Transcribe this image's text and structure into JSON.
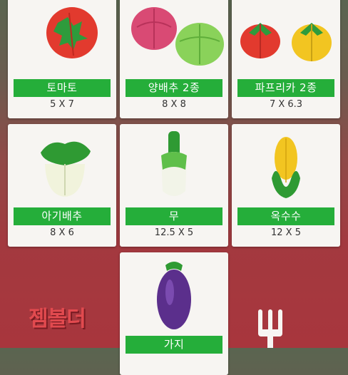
{
  "items": [
    {
      "name": "토마토",
      "size": "5 X 7"
    },
    {
      "name": "양배추 2종",
      "size": "8 X 8"
    },
    {
      "name": "파프리카 2종",
      "size": "7 X 6.3"
    },
    {
      "name": "아기배추",
      "size": "8 X 6"
    },
    {
      "name": "무",
      "size": "12.5 X 5"
    },
    {
      "name": "옥수수",
      "size": "12 X 5"
    },
    {
      "name": "가지",
      "size": ""
    }
  ],
  "brand": {
    "name": "젬볼더"
  },
  "colors": {
    "label_green": "#25ae3a",
    "card_bg": "#f7f5f2",
    "brand_red": "#e24a4f"
  }
}
